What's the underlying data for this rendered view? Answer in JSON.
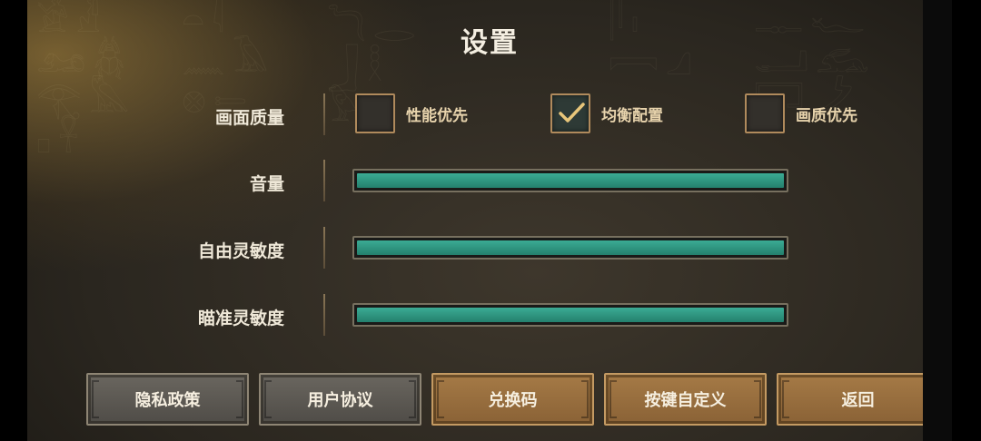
{
  "title": "设置",
  "graphics": {
    "label": "画面质量",
    "options": [
      {
        "label": "性能优先",
        "checked": false
      },
      {
        "label": "均衡配置",
        "checked": true
      },
      {
        "label": "画质优先",
        "checked": false
      }
    ]
  },
  "sliders": [
    {
      "label": "音量",
      "value": 1.0
    },
    {
      "label": "自由灵敏度",
      "value": 1.0
    },
    {
      "label": "瞄准灵敏度",
      "value": 1.0
    }
  ],
  "buttons": [
    "隐私政策",
    "用户协议",
    "兑换码",
    "按键自定义",
    "返回"
  ],
  "colors": {
    "accent_fill": "#2f937e",
    "gold_button": "#9a6e3e",
    "grey_button": "#5c5852",
    "check_mark": "#e8c67a"
  }
}
